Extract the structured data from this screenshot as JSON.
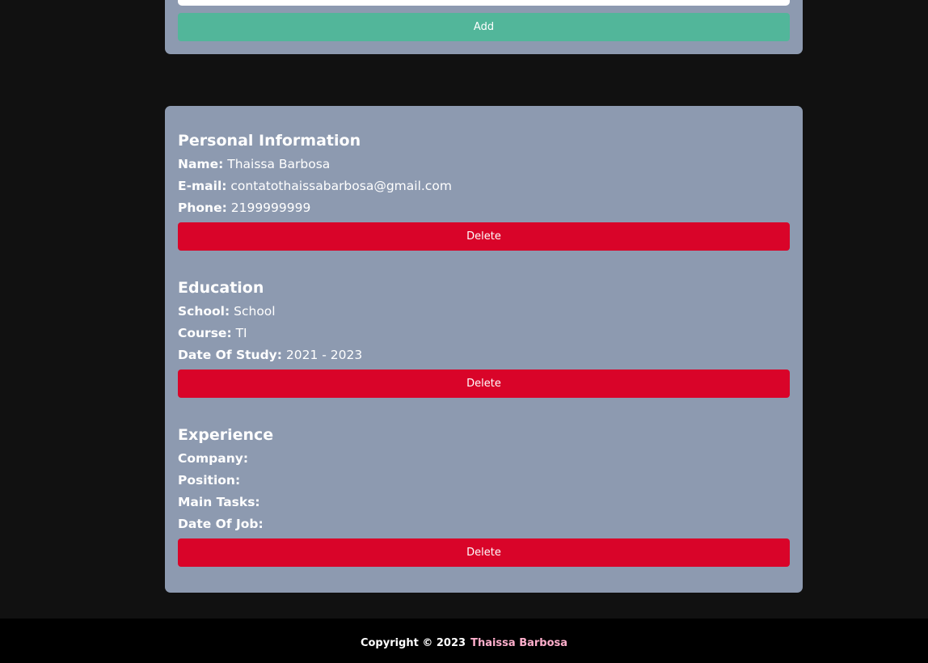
{
  "form": {
    "add_label": "Add"
  },
  "personal": {
    "title": "Personal Information",
    "name_label": "Name:",
    "name_value": "Thaissa Barbosa",
    "email_label": "E-mail:",
    "email_value": "contatothaissabarbosa@gmail.com",
    "phone_label": "Phone:",
    "phone_value": "2199999999",
    "delete_label": "Delete"
  },
  "education": {
    "title": "Education",
    "school_label": "School:",
    "school_value": "School",
    "course_label": "Course:",
    "course_value": "TI",
    "date_label": "Date Of Study:",
    "date_value": "2021 - 2023",
    "delete_label": "Delete"
  },
  "experience": {
    "title": "Experience",
    "company_label": "Company:",
    "company_value": "",
    "position_label": "Position:",
    "position_value": "",
    "tasks_label": "Main Tasks:",
    "tasks_value": "",
    "date_label": "Date Of Job:",
    "date_value": "",
    "delete_label": "Delete"
  },
  "footer": {
    "copyright": "Copyright © 2023",
    "author": "Thaissa Barbosa",
    "author_color": "#ffafcc"
  },
  "colors": {
    "background": "#111111",
    "card": "#8d9ab0",
    "add_button": "#52b69a",
    "delete_button": "#d90429",
    "footer": "#000000"
  }
}
